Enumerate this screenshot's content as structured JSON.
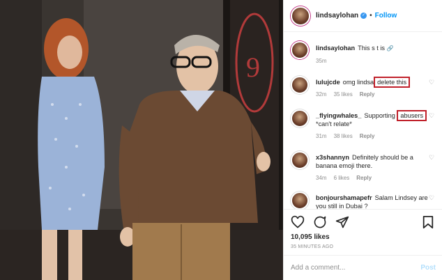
{
  "header": {
    "username": "lindsaylohan",
    "dot": "•",
    "follow_label": "Follow"
  },
  "caption": {
    "username": "lindsaylohan",
    "text": "This s  t is ",
    "time": "35m"
  },
  "comments": [
    {
      "username": "lulujcde",
      "text_before": "omg lindsa",
      "highlight": "delete this",
      "text_after": "",
      "time": "32m",
      "likes": "35 likes",
      "reply": "Reply"
    },
    {
      "username": "_flyingwhales_",
      "text_before": "Supporting ",
      "highlight": "abusers",
      "text_after": " *can't relate*",
      "time": "31m",
      "likes": "38 likes",
      "reply": "Reply"
    },
    {
      "username": "x3shannyn",
      "text_before": "Definitely should be a banana emoji there.",
      "highlight": "",
      "text_after": "",
      "time": "34m",
      "likes": "6 likes",
      "reply": "Reply"
    },
    {
      "username": "bonjourshamapefr",
      "text_before": "Salam Lindsey are you still in Dubai ?",
      "highlight": "",
      "text_after": "",
      "time": "",
      "likes": "",
      "reply": ""
    }
  ],
  "actions": {
    "likes": "10,095 likes",
    "timestamp": "35 MINUTES AGO"
  },
  "add_comment": {
    "placeholder": "Add a comment...",
    "post_label": "Post"
  },
  "colors": {
    "link_blue": "#0095f6",
    "highlight_red": "#c0202a",
    "muted": "#8e8e8e"
  }
}
